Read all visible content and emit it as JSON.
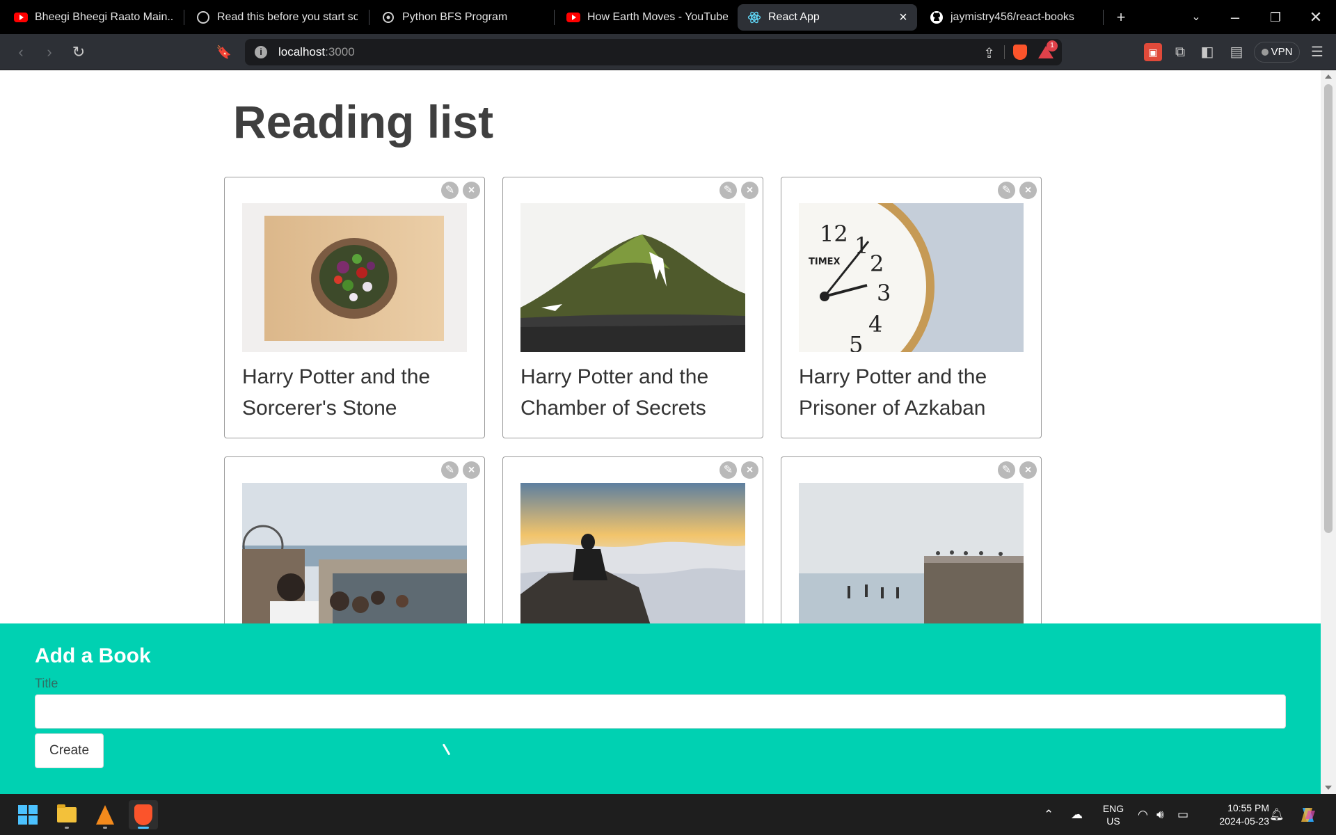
{
  "browser": {
    "tabs": [
      {
        "title": "Bheegi Bheegi Raato Main...! - Y",
        "icon": "youtube-icon",
        "active": false
      },
      {
        "title": "Read this before you start solvi",
        "icon": "site-icon",
        "active": false
      },
      {
        "title": "Python BFS Program",
        "icon": "openai-icon",
        "active": false
      },
      {
        "title": "How Earth Moves - YouTube",
        "icon": "youtube-icon",
        "active": false
      },
      {
        "title": "React App",
        "icon": "react-icon",
        "active": true
      },
      {
        "title": "jaymistry456/react-books",
        "icon": "github-icon",
        "active": false
      }
    ],
    "new_tab_symbol": "+",
    "address": {
      "host": "localhost",
      "port": ":3000"
    },
    "rewards_count": "1",
    "vpn_label": "VPN"
  },
  "page": {
    "title": "Reading list",
    "books": [
      {
        "title": "Harry Potter and the Sorcerer's Stone",
        "image": "bowl-of-salad"
      },
      {
        "title": "Harry Potter and the Chamber of Secrets",
        "image": "green-mountain"
      },
      {
        "title": "Harry Potter and the Prisoner of Azkaban",
        "image": "alarm-clock"
      },
      {
        "title": "",
        "image": "beach-pier-crowd"
      },
      {
        "title": "",
        "image": "man-above-clouds"
      },
      {
        "title": "",
        "image": "sea-pillar-birds"
      }
    ],
    "clock_image": {
      "brand": "TIMEX",
      "numbers": [
        "12",
        "1",
        "2",
        "3",
        "4",
        "5"
      ]
    },
    "card_actions": {
      "edit_icon": "edit-icon",
      "delete_icon": "close-icon",
      "delete_symbol": "×"
    }
  },
  "add_form": {
    "heading": "Add a Book",
    "label": "Title",
    "input_value": "",
    "button_label": "Create"
  },
  "taskbar": {
    "apps": [
      "windows-start",
      "file-explorer",
      "vlc",
      "brave"
    ],
    "lang_top": "ENG",
    "lang_bottom": "US",
    "time": "10:55 PM",
    "date": "2024-05-23"
  },
  "colors": {
    "accent_teal": "#00d1b2",
    "tab_bar": "#000000",
    "toolbar": "#2d3036"
  }
}
